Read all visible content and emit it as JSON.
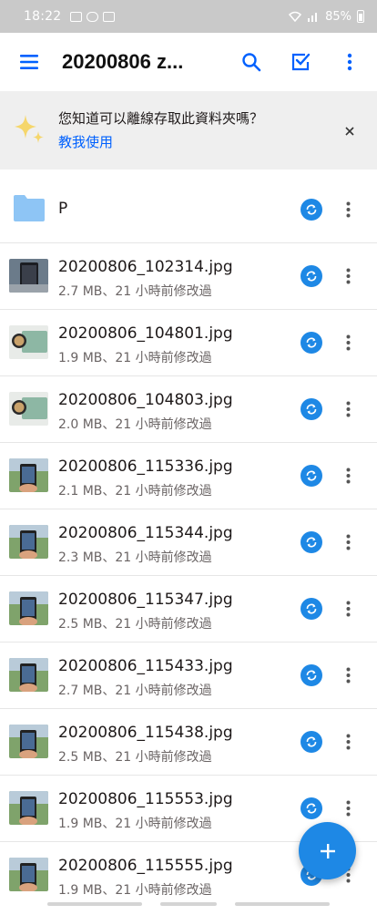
{
  "status_bar": {
    "time": "18:22",
    "battery": "85%"
  },
  "app_bar": {
    "title": "20200806 z...",
    "icons": [
      "menu-icon",
      "search-icon",
      "select-checkbox-icon",
      "more-vert-icon"
    ]
  },
  "banner": {
    "question": "您知道可以離線存取此資料夾嗎？",
    "link": "教我使用",
    "icon": "sparkle-icon"
  },
  "folder": {
    "name": "P"
  },
  "files": [
    {
      "name": "20200806_102314.jpg",
      "meta": "2.7 MB、21 小時前修改過",
      "thumb": "phone-dark"
    },
    {
      "name": "20200806_104801.jpg",
      "meta": "1.9 MB、21 小時前修改過",
      "thumb": "watch-green"
    },
    {
      "name": "20200806_104803.jpg",
      "meta": "2.0 MB、21 小時前修改過",
      "thumb": "watch-green"
    },
    {
      "name": "20200806_115336.jpg",
      "meta": "2.1 MB、21 小時前修改過",
      "thumb": "hand-phone"
    },
    {
      "name": "20200806_115344.jpg",
      "meta": "2.3 MB、21 小時前修改過",
      "thumb": "hand-phone"
    },
    {
      "name": "20200806_115347.jpg",
      "meta": "2.5 MB、21 小時前修改過",
      "thumb": "hand-phone"
    },
    {
      "name": "20200806_115433.jpg",
      "meta": "2.7 MB、21 小時前修改過",
      "thumb": "hand-phone"
    },
    {
      "name": "20200806_115438.jpg",
      "meta": "2.5 MB、21 小時前修改過",
      "thumb": "hand-phone"
    },
    {
      "name": "20200806_115553.jpg",
      "meta": "1.9 MB、21 小時前修改過",
      "thumb": "hand-phone"
    },
    {
      "name": "20200806_115555.jpg",
      "meta": "1.9 MB、21 小時前修改過",
      "thumb": "hand-phone"
    }
  ],
  "colors": {
    "accent": "#0061fe",
    "sync_badge": "#1e88e5",
    "banner_bg": "#efefef",
    "folder": "#8ec5f5"
  }
}
